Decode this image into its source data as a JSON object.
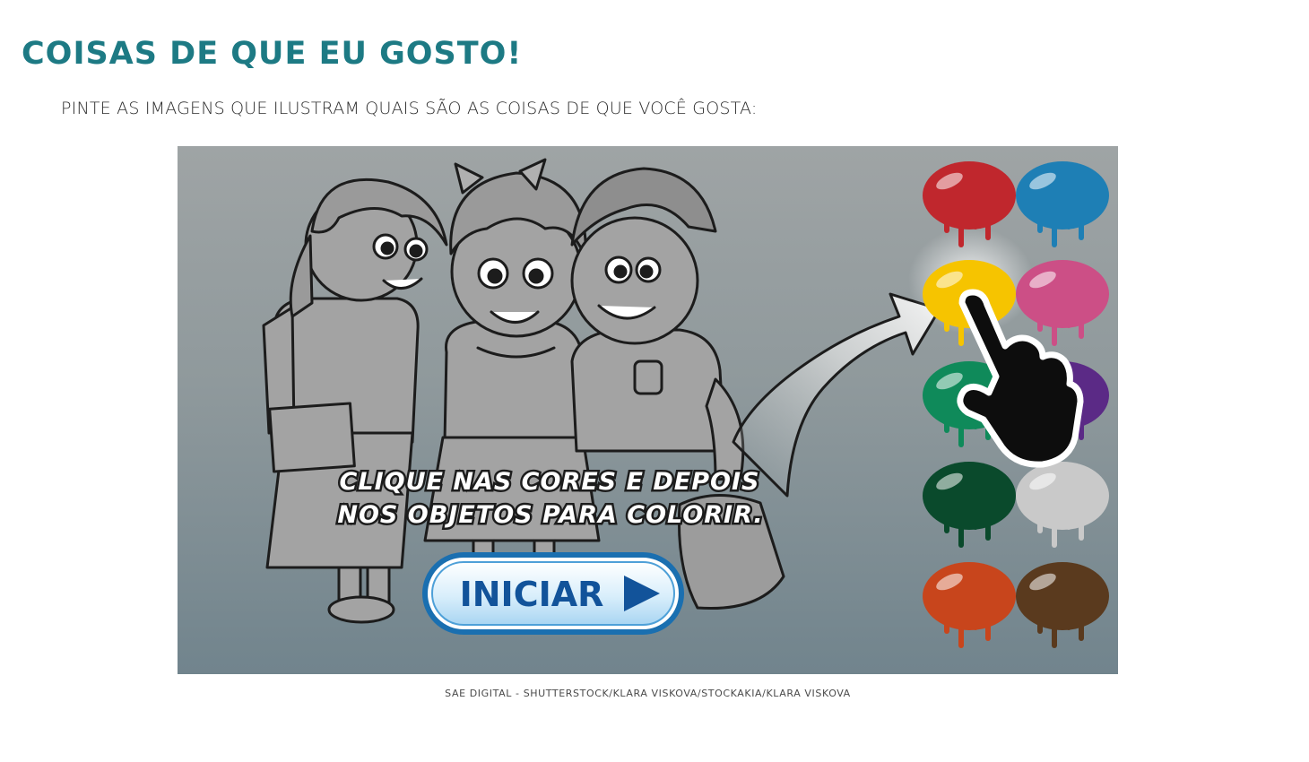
{
  "page": {
    "title": "COISAS DE QUE EU GOSTO!",
    "instruction": "PINTE AS IMAGENS QUE ILUSTRAM QUAIS SÃO AS COISAS DE QUE VOCÊ GOSTA:",
    "credit": "SAE DIGITAL - SHUTTERSTOCK/KLARA VISKOVA/STOCKAKIA/KLARA VISKOVA"
  },
  "game": {
    "prompt_line_1": "CLIQUE NAS CORES E DEPOIS",
    "prompt_line_2": "NOS OBJETOS PARA COLORIR.",
    "start_button_label": "INICIAR",
    "palette": [
      {
        "name": "red",
        "color": "#c0272d"
      },
      {
        "name": "blue",
        "color": "#1e7fb5"
      },
      {
        "name": "yellow",
        "color": "#f6c400"
      },
      {
        "name": "pink",
        "color": "#cc4f86"
      },
      {
        "name": "green",
        "color": "#0f8a5a"
      },
      {
        "name": "purple",
        "color": "#5b2a86"
      },
      {
        "name": "dark-green",
        "color": "#0a4a2c"
      },
      {
        "name": "light-gray",
        "color": "#c9c9c9"
      },
      {
        "name": "orange",
        "color": "#c8451c"
      },
      {
        "name": "brown",
        "color": "#5a3a1e"
      }
    ]
  },
  "colors": {
    "title": "#1d7a84",
    "button_border": "#1a6fb0",
    "button_text": "#12539a"
  }
}
